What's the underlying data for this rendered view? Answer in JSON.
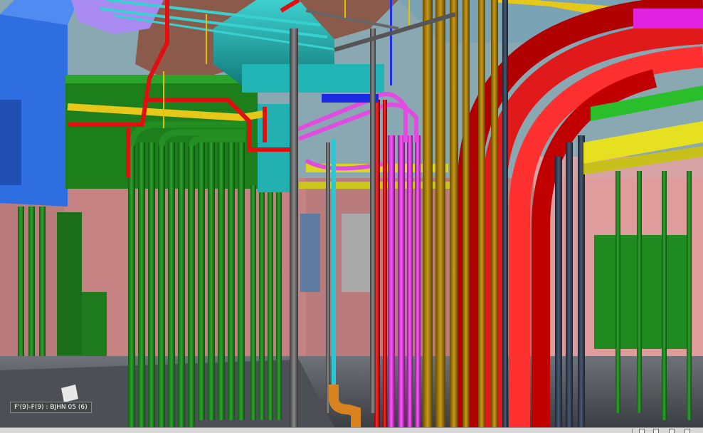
{
  "viewport": {
    "level_label": "F'(9)-F(9) : BJHN 05 (6)"
  },
  "status_bar": {
    "icons": [
      "navigation-icon",
      "view-cube-icon",
      "settings-icon",
      "nav-wheel-icon"
    ]
  },
  "colors": {
    "fire_sprinkler": "#e01010",
    "electrical_conduit": "#1f8a1f",
    "plumbing": "#d94cd9",
    "hvac_duct": "#20b0b0",
    "structure": "#6a6a6a",
    "gas_pipe": "#b98a0a",
    "cable_tray": "#e6d21a"
  }
}
